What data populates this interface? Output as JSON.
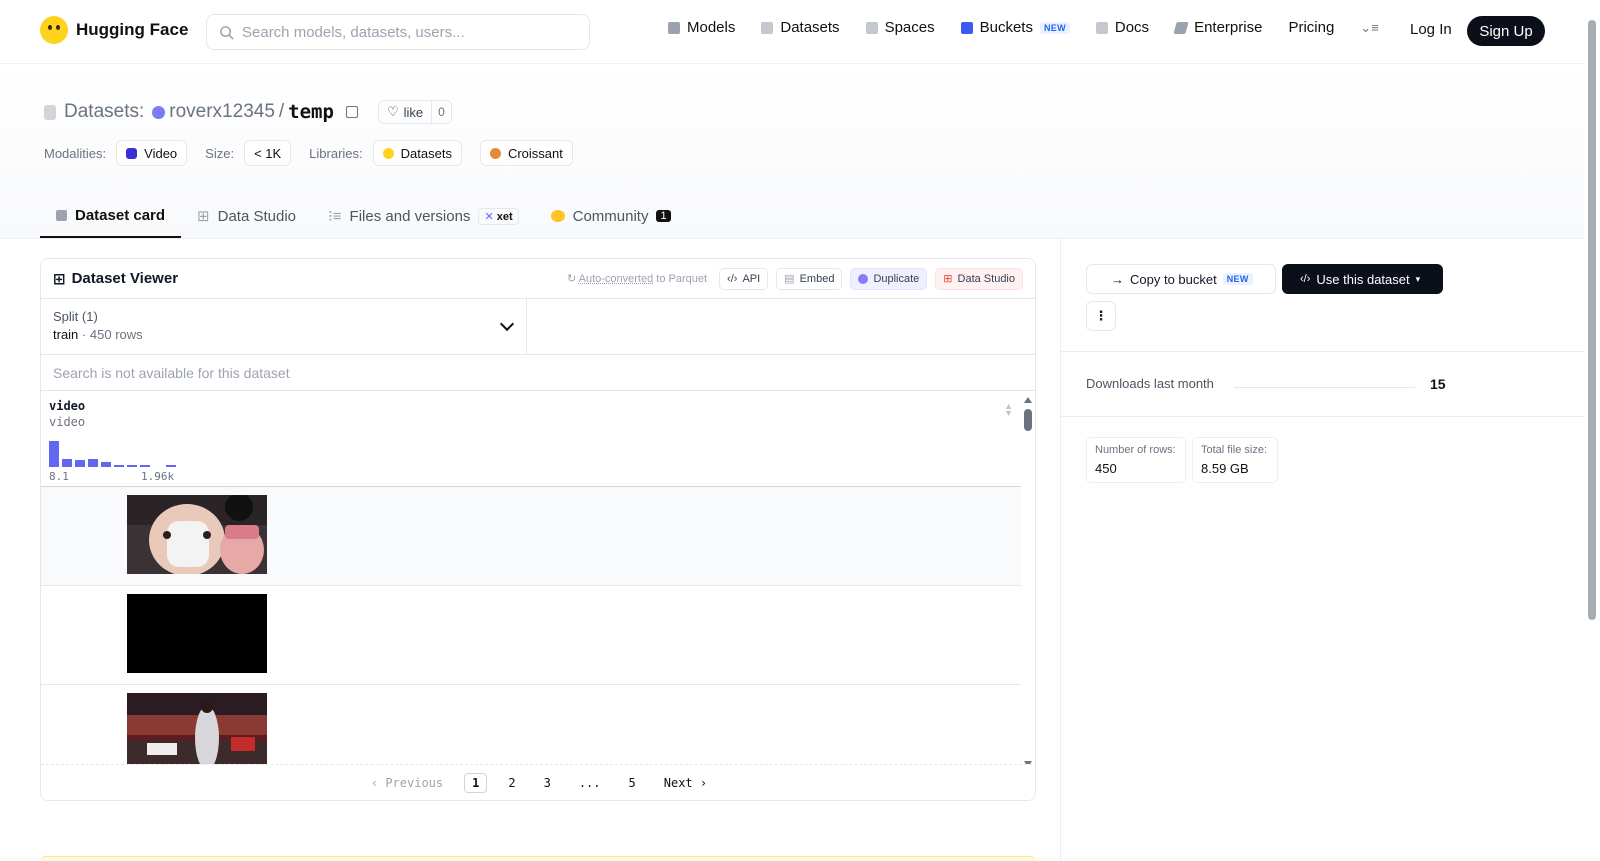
{
  "nav": {
    "brand": "Hugging Face",
    "search_placeholder": "Search models, datasets, users...",
    "links": [
      "Models",
      "Datasets",
      "Spaces",
      "Buckets",
      "Docs",
      "Enterprise",
      "Pricing"
    ],
    "buckets_badge": "NEW",
    "login": "Log In",
    "signup": "Sign Up"
  },
  "header": {
    "section": "Datasets:",
    "owner": "roverx12345",
    "separator": "/",
    "repo": "temp",
    "like_label": "like",
    "like_count": "0",
    "modalities_label": "Modalities:",
    "modality": "Video",
    "size_label": "Size:",
    "size": "< 1K",
    "libraries_label": "Libraries:",
    "libraries": [
      "Datasets",
      "Croissant"
    ]
  },
  "tabs": {
    "dataset_card": "Dataset card",
    "data_studio": "Data Studio",
    "files": "Files and versions",
    "xet": "xet",
    "community": "Community",
    "community_count": "1"
  },
  "viewer": {
    "title": "Dataset Viewer",
    "auto_converted": "Auto-converted",
    "to_parquet": " to Parquet",
    "api": "API",
    "embed": "Embed",
    "duplicate": "Duplicate",
    "data_studio": "Data Studio",
    "split_label": "Split (1)",
    "split_name": "train",
    "split_sep": "·",
    "split_rows": "450 rows",
    "search_na": "Search is not available for this dataset",
    "column_name": "video",
    "column_type": "video",
    "hist_min": "8.1",
    "hist_max": "1.96k",
    "hist_levels": [
      1.0,
      0.32,
      0.26,
      0.3,
      0.2,
      0.07,
      0.07,
      0.07,
      0.0,
      0.07
    ],
    "pager": {
      "prev": "‹ Previous",
      "pages": [
        "1",
        "2",
        "3",
        "...",
        "5"
      ],
      "next": "Next ›"
    }
  },
  "sidebar": {
    "copy_bucket": "Copy to bucket",
    "copy_badge": "NEW",
    "use_dataset": "Use this dataset",
    "downloads_label": "Downloads last month",
    "downloads": "15",
    "rows_label": "Number of rows:",
    "rows": "450",
    "filesize_label": "Total file size:",
    "filesize": "8.59 GB"
  }
}
